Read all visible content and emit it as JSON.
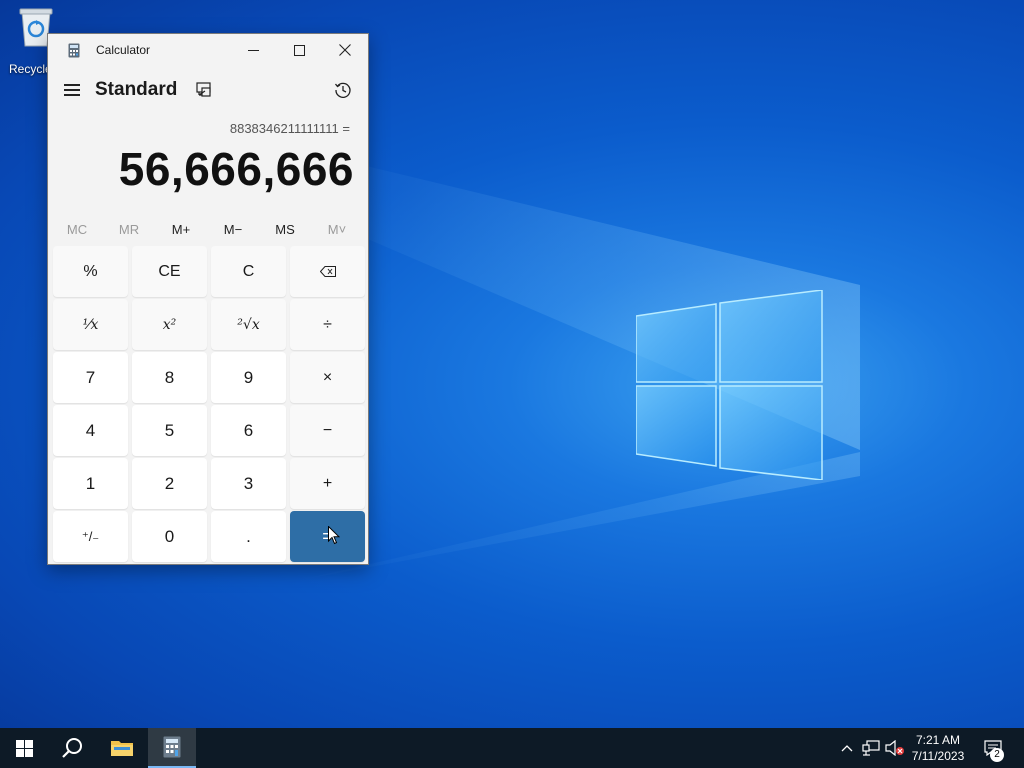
{
  "desktop": {
    "icons": [
      {
        "label": "Recycle"
      }
    ]
  },
  "window": {
    "title": "Calculator",
    "mode": "Standard",
    "expression": "8838346211111111 =",
    "result": "56,666,666",
    "memory": [
      "MC",
      "MR",
      "M+",
      "M−",
      "MS",
      "M˅"
    ],
    "keys": {
      "percent": "%",
      "ce": "CE",
      "c": "C",
      "backspace": "⌫",
      "divide": "÷",
      "multiply": "×",
      "minus": "−",
      "plus": "+",
      "equals": "=",
      "negate": "⁺/₋",
      "decimal": ".",
      "d0": "0",
      "d1": "1",
      "d2": "2",
      "d3": "3",
      "d4": "4",
      "d5": "5",
      "d6": "6",
      "d7": "7",
      "d8": "8",
      "d9": "9"
    }
  },
  "taskbar": {
    "time": "7:21 AM",
    "date": "7/11/2023",
    "notification_count": "2"
  }
}
